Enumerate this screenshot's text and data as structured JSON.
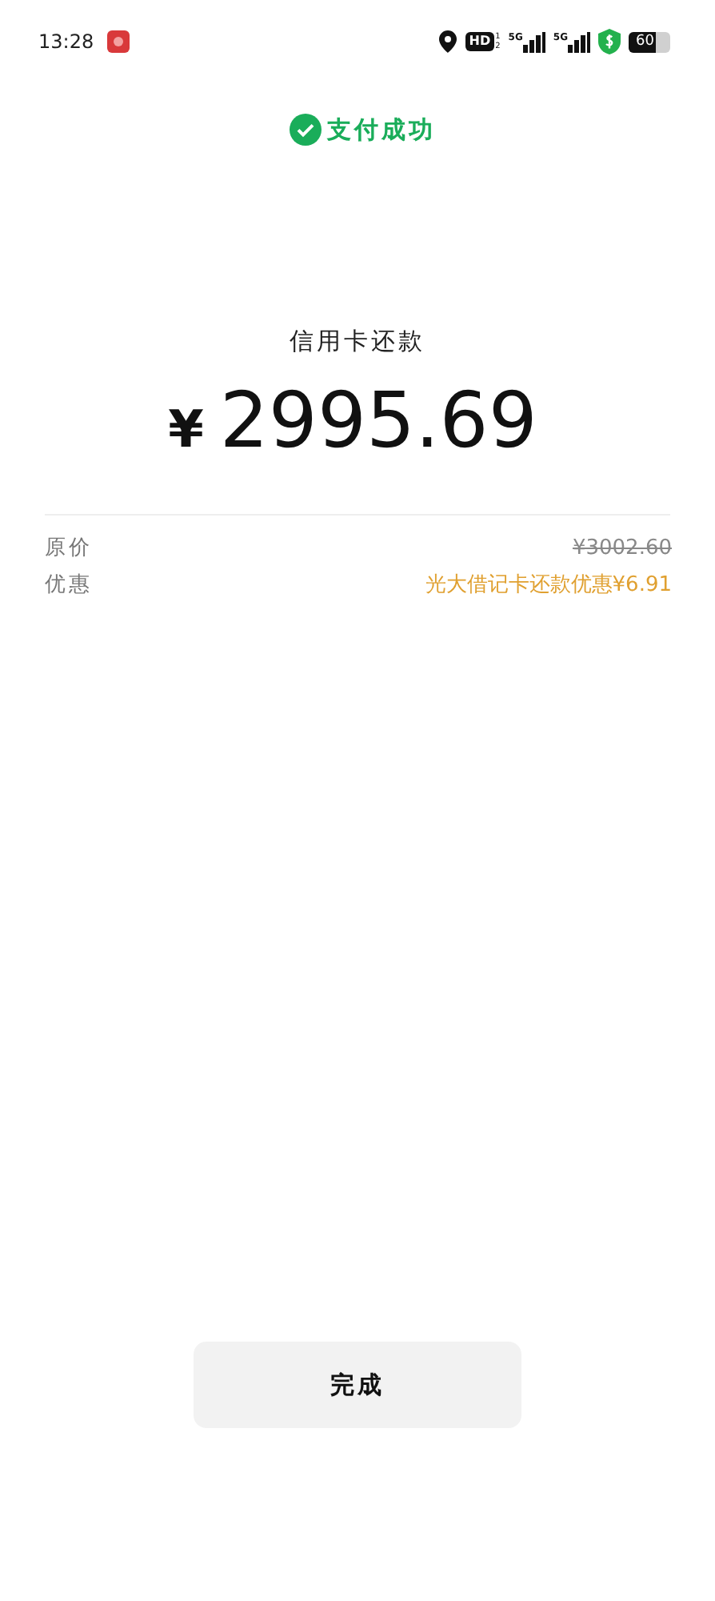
{
  "status_bar": {
    "time": "13:28",
    "hd": "HD",
    "hd_slots": [
      "1",
      "2"
    ],
    "networks": [
      "5G",
      "5G"
    ],
    "battery": "60"
  },
  "result": {
    "status": "支付成功",
    "title": "信用卡还款",
    "currency": "¥",
    "amount": "2995.69"
  },
  "details": [
    {
      "label": "原价",
      "value": "¥3002.60",
      "kind": "struck"
    },
    {
      "label": "优惠",
      "value": "光大借记卡还款优惠¥6.91",
      "kind": "discount"
    }
  ],
  "buttons": [
    "完成"
  ]
}
